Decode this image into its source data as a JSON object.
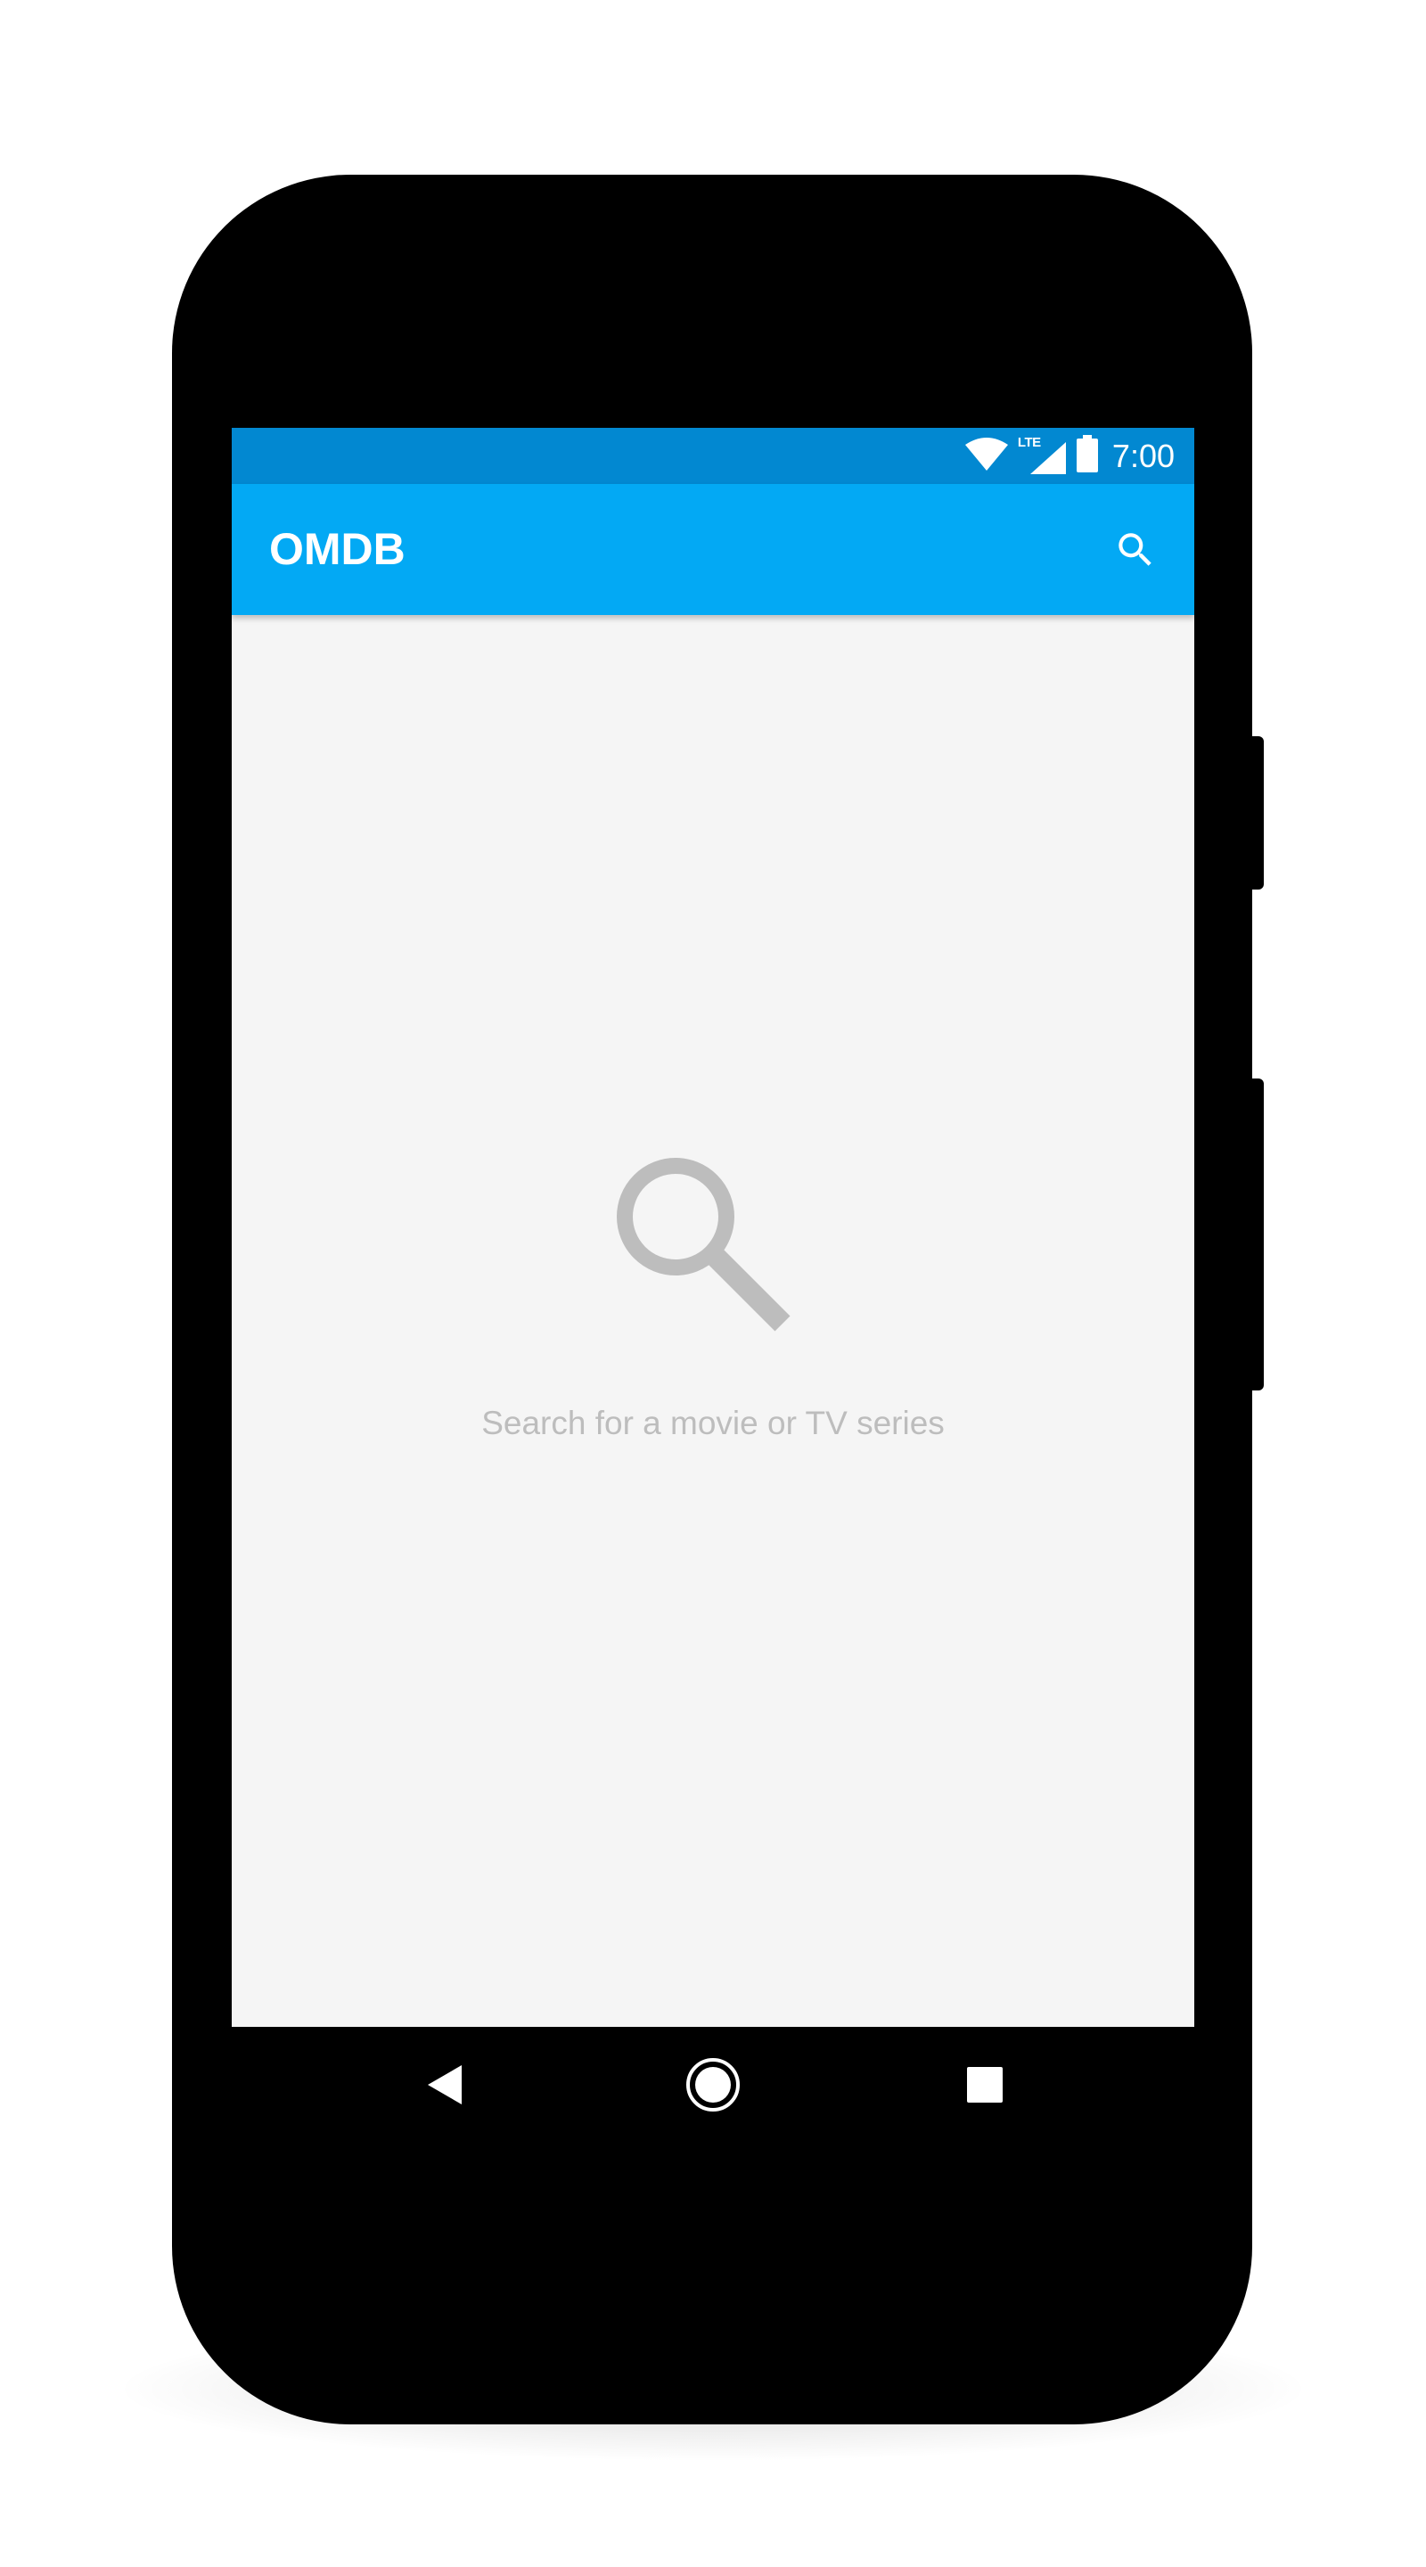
{
  "status_bar": {
    "time": "7:00",
    "network_label": "LTE",
    "color": "#0288d1"
  },
  "app_bar": {
    "title": "OMDB",
    "color": "#03a9f4",
    "action_icon": "search-icon"
  },
  "empty_state": {
    "icon": "search-icon",
    "message": "Search for a movie or TV series",
    "text_color": "#bdbdbd"
  },
  "nav_bar": {
    "back_icon": "back-triangle-icon",
    "home_icon": "home-circle-icon",
    "recents_icon": "recents-square-icon"
  },
  "colors": {
    "screen_background": "#f5f5f5",
    "phone_body": "#000000"
  }
}
